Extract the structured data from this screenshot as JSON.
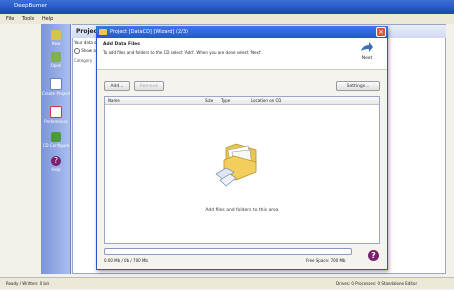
{
  "app": {
    "title": "DeepBurner"
  },
  "menu": [
    "File",
    "Tools",
    "Help"
  ],
  "sidebar": [
    {
      "label": "New",
      "icon": "new-icon",
      "color": "#d8c24a"
    },
    {
      "label": "Open",
      "icon": "open-folder-icon",
      "color": "#7fb24a"
    },
    {
      "label": "Create Project",
      "icon": "project-icon",
      "color": "#ffffff"
    },
    {
      "label": "Preferences",
      "icon": "preferences-icon",
      "color": "#d63b3b"
    },
    {
      "label": "CD Configure",
      "icon": "cd-configure-icon",
      "color": "#4a9a3a"
    },
    {
      "label": "Help",
      "icon": "help-icon",
      "color": "#7b1f6e"
    }
  ],
  "project": {
    "title": "Project Sta",
    "sub": "Your data should",
    "show_all": "Show all",
    "column": "Category"
  },
  "dialog": {
    "title": "Project [DataCD] [Wizard] (2/3)",
    "heading": "Add Data Files",
    "description": "To add files and folders to the CD select 'Add'. When you are done select 'Next'.",
    "next_label": "Next",
    "add_label": "Add...",
    "remove_label": "Remove",
    "settings_label": "Settings...",
    "columns": [
      "Name",
      "Size",
      "Type",
      "Location on CD"
    ],
    "empty_text": "Add files and folders to this area",
    "size_text": "0.00 Mb / 0b / 700 Mb",
    "free_text": "Free Space: 700 Mb"
  },
  "status": {
    "left": "Ready / Written: 0 b/s",
    "right": "Drives: 0  Processes: 0    Standalone Editor"
  },
  "colors": {
    "titlebar": "#2456c4",
    "accent": "#d9533a"
  }
}
